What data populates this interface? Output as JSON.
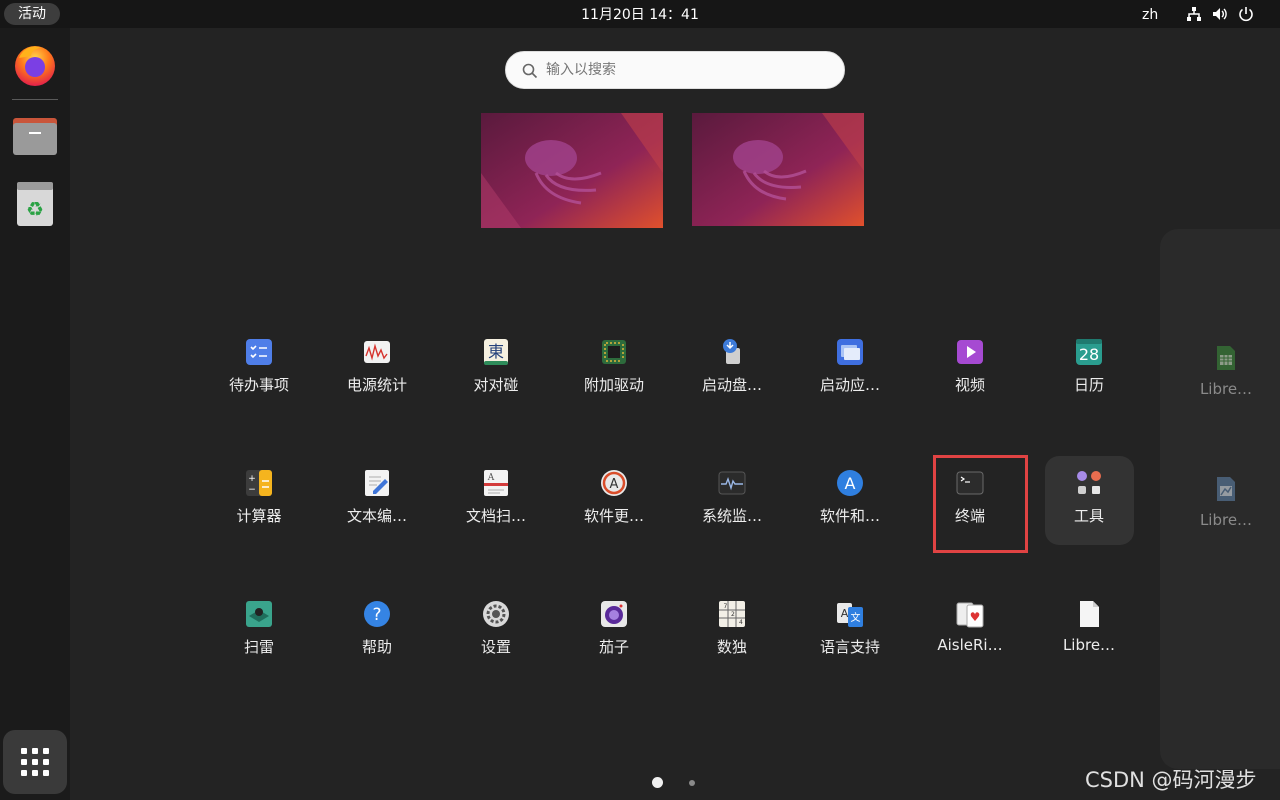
{
  "topbar": {
    "activities_label": "活动",
    "clock": "11月20日  14：41",
    "input_source": "zh",
    "tray_icons": [
      "network-icon",
      "volume-icon",
      "power-icon"
    ]
  },
  "dock": {
    "items": [
      {
        "name": "firefox-icon"
      },
      {
        "name": "files-icon"
      },
      {
        "name": "trash-icon"
      }
    ],
    "show_apps_icon": "grid-icon"
  },
  "search": {
    "placeholder": "输入以搜索"
  },
  "workspaces": [
    "workspace-1",
    "workspace-2"
  ],
  "apps": [
    {
      "label": "待办事项",
      "icon": "todo-icon"
    },
    {
      "label": "电源统计",
      "icon": "power-statistics-icon"
    },
    {
      "label": "对对碰",
      "icon": "mahjongg-icon"
    },
    {
      "label": "附加驱动",
      "icon": "chip-icon"
    },
    {
      "label": "启动盘…",
      "icon": "usb-creator-icon"
    },
    {
      "label": "启动应…",
      "icon": "startup-apps-icon"
    },
    {
      "label": "视频",
      "icon": "video-icon"
    },
    {
      "label": "日历",
      "icon": "calendar-icon",
      "day": "28"
    },
    {
      "label": "计算器",
      "icon": "calculator-icon"
    },
    {
      "label": "文本编…",
      "icon": "text-editor-icon"
    },
    {
      "label": "文档扫…",
      "icon": "scanner-icon"
    },
    {
      "label": "软件更…",
      "icon": "software-updater-icon"
    },
    {
      "label": "系统监…",
      "icon": "system-monitor-icon"
    },
    {
      "label": "软件和…",
      "icon": "software-sources-icon"
    },
    {
      "label": "终端",
      "icon": "terminal-icon"
    },
    {
      "label": "工具",
      "icon": "folder-icon"
    },
    {
      "label": "扫雷",
      "icon": "mines-icon"
    },
    {
      "label": "帮助",
      "icon": "help-icon"
    },
    {
      "label": "设置",
      "icon": "settings-icon"
    },
    {
      "label": "茄子",
      "icon": "cheese-icon"
    },
    {
      "label": "数独",
      "icon": "sudoku-icon"
    },
    {
      "label": "语言支持",
      "icon": "language-icon"
    },
    {
      "label": "AisleRi…",
      "icon": "aisleriot-icon"
    },
    {
      "label": "Libre…",
      "icon": "libreoffice-icon"
    }
  ],
  "next_page_apps": [
    {
      "label": "Libre…",
      "icon": "libreoffice-calc-icon"
    },
    {
      "label": "Libre…",
      "icon": "libreoffice-draw-icon"
    }
  ],
  "pagination": {
    "pages": 2,
    "current": 1
  },
  "watermark": "CSDN @码河漫步",
  "colors": {
    "background": "#232323",
    "topbar": "#161616",
    "dock": "#1b1b1b",
    "highlight": "#e04343"
  }
}
